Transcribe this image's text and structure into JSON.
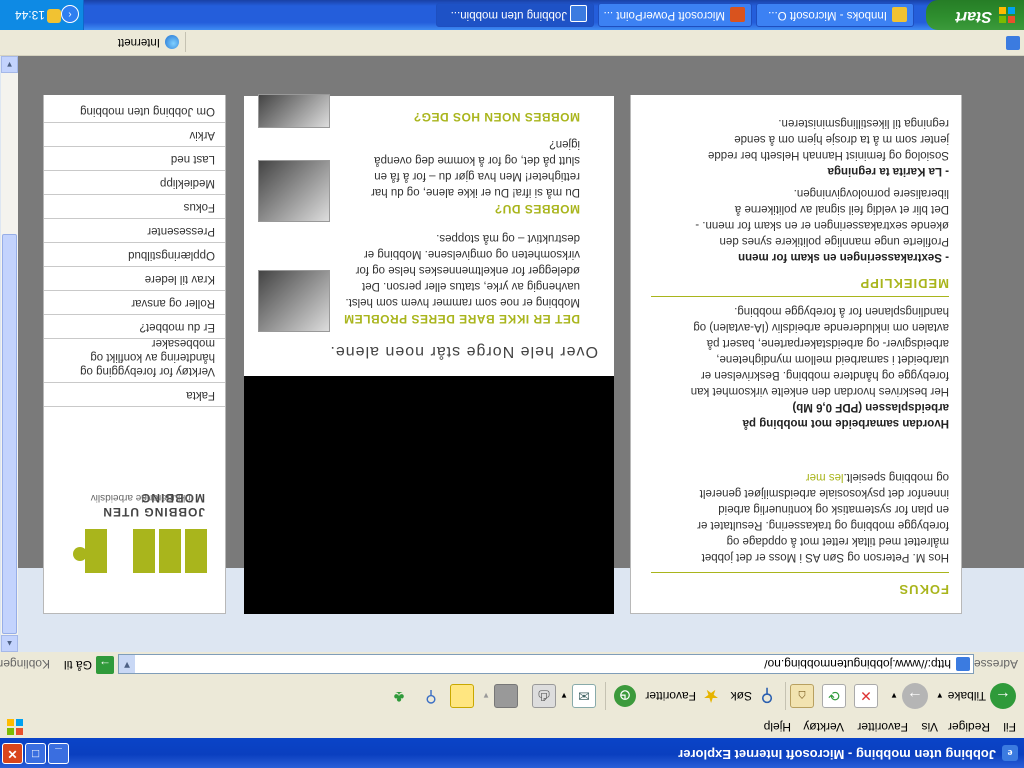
{
  "window": {
    "title": "Jobbing uten mobbing - Microsoft Internet Explorer",
    "controls": {
      "minimize": "_",
      "maximize": "□",
      "close": "✕"
    }
  },
  "menu": [
    "Fil",
    "Rediger",
    "Vis",
    "Favoritter",
    "Verktøy",
    "Hjelp"
  ],
  "toolbar": {
    "back_label": "Tilbake",
    "search_label": "Søk",
    "favorites_label": "Favoritter"
  },
  "address": {
    "label": "Adresse",
    "url": "http://www.jobbingutenmobbing.no/",
    "go_label": "Gå til",
    "links_label": "Koblinger"
  },
  "sidebar": {
    "logo_title": "JOBBING UTEN MOBBING",
    "logo_subtitle": "inkluderende arbeidsliv",
    "items": [
      {
        "label": "Fakta"
      },
      {
        "label": "Verktøy for forebygging og håndtering av konflikt og mobbesaker"
      },
      {
        "label": "Er du mobbet?"
      },
      {
        "label": "Roller og ansvar"
      },
      {
        "label": "Krav til ledere"
      },
      {
        "label": "Opplæringstilbud"
      },
      {
        "label": "Pressesenter"
      },
      {
        "label": "Fokus"
      },
      {
        "label": "Medieklipp"
      },
      {
        "label": "Last ned"
      },
      {
        "label": "Arkiv"
      },
      {
        "label": "Om Jobbing uten mobbing"
      }
    ]
  },
  "main": {
    "title": "Over hele Norge står noen alene.",
    "articles": [
      {
        "heading": "DET ER IKKE BARE DERES PROBLEM",
        "lines": [
          "Mobbing er noe som rammer hvem som helst.",
          "uavhengig av yrke, status eller person. Det",
          "ødelegger for enkeltmenneskes helse og for",
          "virksomheten og omgivelsene. Mobbing er",
          "destruktivt – og må stoppes."
        ]
      },
      {
        "heading": "MOBBES DU?",
        "lines": [
          "Du må si ifra! Du er ikke alene, og du har",
          "rettigheter! Men hva gjør du – for å få en",
          "slutt på det, og for å komme deg ovenpå",
          "igjen?"
        ]
      },
      {
        "heading": "MOBBES NOEN HOS DEG?",
        "lines": []
      }
    ]
  },
  "right": {
    "fokus": {
      "heading": "FOKUS",
      "lines": [
        "Hos M. Peterson og Søn AS i Moss er det jobbet",
        "målrettet med tiltak rettet mot å oppdage og",
        "forebygge mobbing og trakassering. Resultatet er",
        "en plan for systematisk og kontinuerlig arbeid",
        "innenfor det psykososiale arbeidsmiljøet generelt",
        "og mobbing spesielt."
      ],
      "read_more": "les mer"
    },
    "pdf": {
      "heading_line1": "Hvordan samarbeide mot mobbing på",
      "heading_line2": "arbeidsplassen (PDF 0,6 Mb)",
      "lines": [
        "Her beskrives hvordan den enkelte virksomhet kan",
        "forebygge og håndtere mobbing. Beskrivelsen er",
        "utarbeidet i samarbeid mellom myndighetene,",
        "arbeidsgiver- og arbeidstakerpartene, basert på",
        "avtalen om inkluderende arbeidsliv (IA-avtalen) og",
        "handlingsplanen for å forebygge mobbing."
      ]
    },
    "medieklipp": {
      "heading": "MEDIEKLIPP",
      "items": [
        {
          "title": "- Sextrakasseringen en skam for menn",
          "lines": [
            "Profilerte unge mannlige politikere synes den",
            "økende sextrakasseringen er en skam for menn. -",
            "Det blir et veldig feil signal av politikerne å",
            "liberalisere pornolovgivningen."
          ]
        },
        {
          "title": "- La Karita ta regninga",
          "lines": [
            "Sosiolog og feminist Hannah Helseth ber redde",
            "jenter som m å ta drosje hjem om å sende",
            "regninga til likestillingsministeren."
          ]
        }
      ]
    }
  },
  "statusbar": {
    "zone": "Internett"
  },
  "taskbar": {
    "start": "Start",
    "tasks": [
      {
        "label": "Innboks - Microsoft O..."
      },
      {
        "label": "Microsoft PowerPoint ..."
      },
      {
        "label": "Jobbing uten mobbin..."
      }
    ],
    "clock": "13:44"
  }
}
